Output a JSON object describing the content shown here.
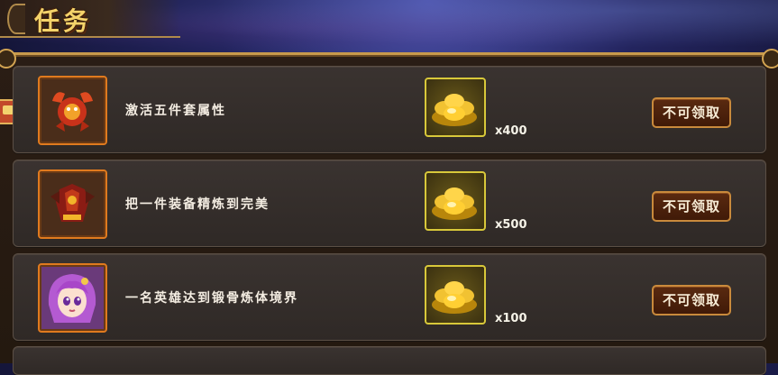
{
  "header": {
    "title": "任务"
  },
  "tasks": [
    {
      "title": "激活五件套属性",
      "reward_count": "x400",
      "button_label": "不可领取",
      "hero_icon": "crab-monster-icon",
      "reward_icon": "gold-ingot-icon"
    },
    {
      "title": "把一件装备精炼到完美",
      "reward_count": "x500",
      "button_label": "不可领取",
      "hero_icon": "armor-icon",
      "reward_icon": "gold-ingot-icon"
    },
    {
      "title": "一名英雄达到锻骨炼体境界",
      "reward_count": "x100",
      "button_label": "不可领取",
      "hero_icon": "hero-portrait-icon",
      "reward_icon": "gold-ingot-icon"
    }
  ],
  "colors": {
    "accent_gold": "#f5d36a",
    "frame_orange": "#e07a1e",
    "reward_frame_yellow": "#d8c83a",
    "button_brown": "#4a200c"
  }
}
